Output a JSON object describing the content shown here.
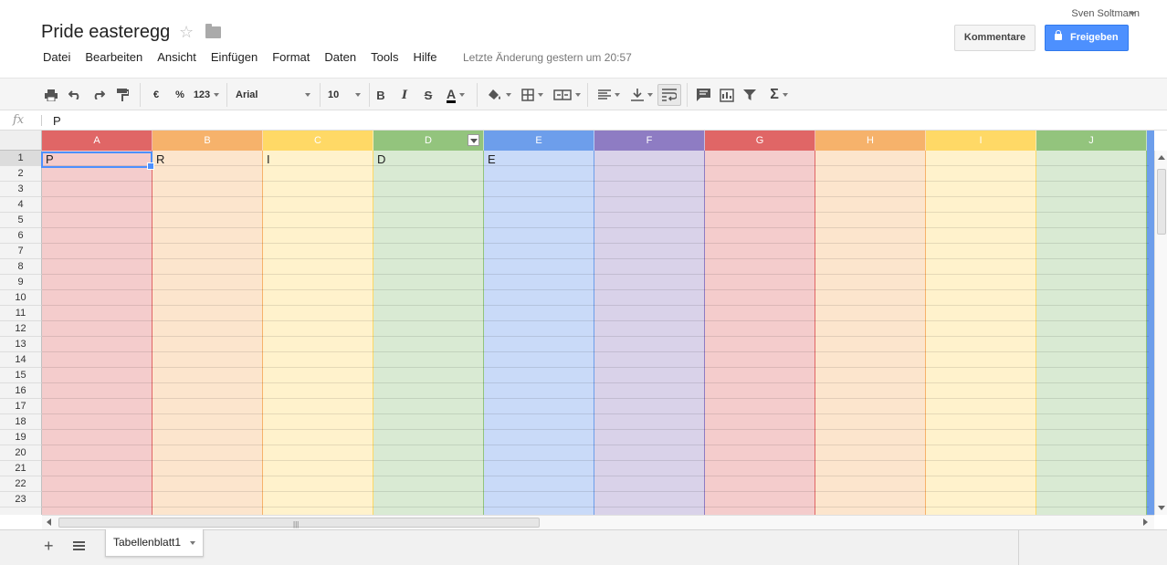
{
  "header": {
    "title": "Pride easteregg",
    "star_icon": "star-outline-icon",
    "folder_icon": "folder-icon",
    "user": "Sven Soltmann",
    "last_change": "Letzte Änderung gestern um 20:57",
    "comments_label": "Kommentare",
    "share_label": "Freigeben",
    "share_color": "#4d90fe"
  },
  "menu": [
    "Datei",
    "Bearbeiten",
    "Ansicht",
    "Einfügen",
    "Format",
    "Daten",
    "Tools",
    "Hilfe"
  ],
  "toolbar": {
    "currency": "€",
    "percent": "%",
    "number_format": "123",
    "font": "Arial",
    "font_size": "10",
    "bold": "B",
    "italic": "I",
    "strike": "S",
    "text_color": "A",
    "sum": "Σ"
  },
  "formula_bar": {
    "fx": "fx",
    "value": "P"
  },
  "grid": {
    "columns": [
      {
        "letter": "A",
        "header_color": "#e06666",
        "fill": "#f4cccc"
      },
      {
        "letter": "B",
        "header_color": "#f6b26b",
        "fill": "#fce5cd"
      },
      {
        "letter": "C",
        "header_color": "#ffd966",
        "fill": "#fff2cc"
      },
      {
        "letter": "D",
        "header_color": "#93c47d",
        "fill": "#d9ead3",
        "filter": true
      },
      {
        "letter": "E",
        "header_color": "#6d9eeb",
        "fill": "#c9daf8"
      },
      {
        "letter": "F",
        "header_color": "#8e7cc3",
        "fill": "#d9d2e9"
      },
      {
        "letter": "G",
        "header_color": "#e06666",
        "fill": "#f4cccc"
      },
      {
        "letter": "H",
        "header_color": "#f6b26b",
        "fill": "#fce5cd"
      },
      {
        "letter": "I",
        "header_color": "#ffd966",
        "fill": "#fff2cc"
      },
      {
        "letter": "J",
        "header_color": "#93c47d",
        "fill": "#d9ead3"
      }
    ],
    "rows": [
      "1",
      "2",
      "3",
      "4",
      "5",
      "6",
      "7",
      "8",
      "9",
      "10",
      "11",
      "12",
      "13",
      "14",
      "15",
      "16",
      "17",
      "18",
      "19",
      "20",
      "21",
      "22",
      "23"
    ],
    "row1_values": [
      "P",
      "R",
      "I",
      "D",
      "E"
    ],
    "selected_cell": "A1"
  },
  "sheets": {
    "add_icon": "plus-icon",
    "list_icon": "sheet-list-icon",
    "tab_label": "Tabellenblatt1"
  }
}
